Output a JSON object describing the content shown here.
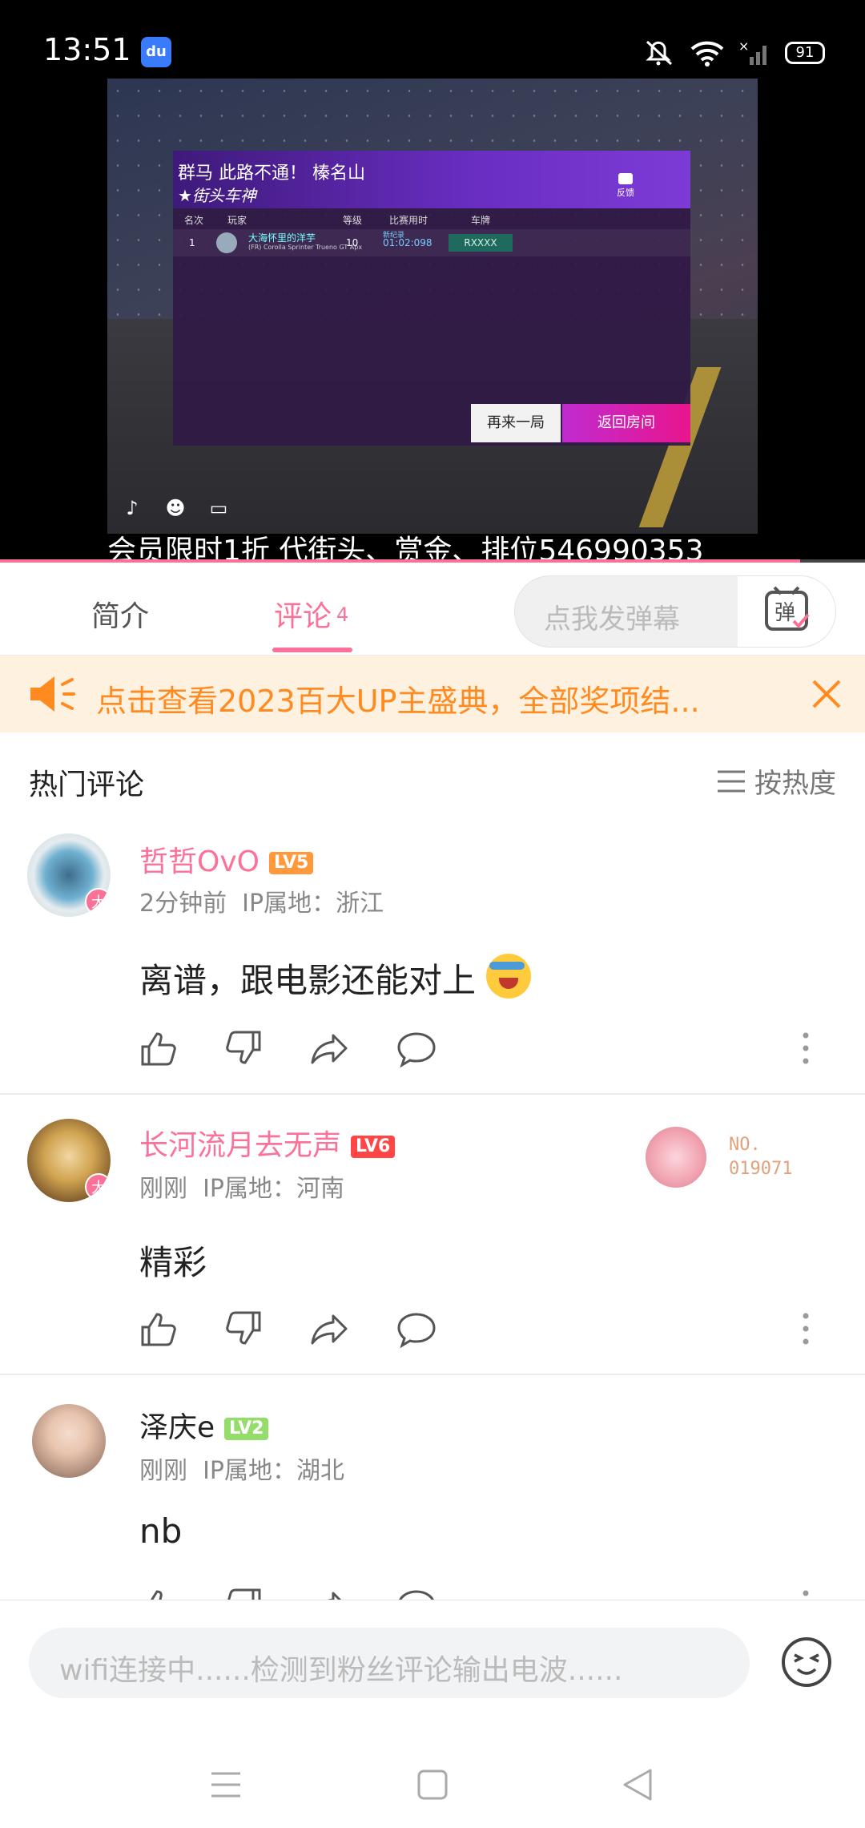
{
  "status_bar": {
    "time": "13:51",
    "battery": "91",
    "icons": [
      "baidu-app-icon",
      "mute-icon",
      "wifi-icon",
      "signal-icon",
      "battery-icon"
    ]
  },
  "video": {
    "game_title": "群马 此路不通！ 榛名山",
    "game_subtitle": "街头车神",
    "feedback_label": "反馈",
    "table_headers": [
      "名次",
      "玩家",
      "等级",
      "比赛用时",
      "车牌"
    ],
    "table_row": {
      "rank": "1",
      "player": "大海怀里的洋芋",
      "car": "(FR) Corolla Sprinter Trueno GT Apx",
      "level": "10",
      "time_label": "新纪录",
      "time": "01:02:098",
      "plate": "RXXXX"
    },
    "btn_again": "再来一局",
    "btn_return": "返回房间",
    "caption": "会员限时1折  代街头、赏金、排位546990353",
    "progress": 0.925
  },
  "tabs": {
    "intro": "简介",
    "comments": "评论",
    "comments_count": "4",
    "danmaku_placeholder": "点我发弹幕",
    "danmaku_button_label": "弹"
  },
  "banner": {
    "text": "点击查看2023百大UP主盛典，全部奖项结..."
  },
  "comments_section": {
    "header": "热门评论",
    "sort_label": "按热度"
  },
  "comments": [
    {
      "username": "哲哲OvO",
      "level": "LV5",
      "vip_badge": "大",
      "time": "2分钟前",
      "ip": "IP属地：浙江",
      "text": "离谱，跟电影还能对上"
    },
    {
      "username": "长河流月去无声",
      "level": "LV6",
      "vip_badge": "大",
      "time": "刚刚",
      "ip": "IP属地：河南",
      "text": "精彩",
      "fan_number_label": "NO.",
      "fan_number": "019071"
    },
    {
      "username": "泽庆e",
      "level": "LV2",
      "time": "刚刚",
      "ip": "IP属地：湖北",
      "text": "nb"
    }
  ],
  "bottom_input": {
    "placeholder": "wifi连接中......检测到粉丝评论输出电波......"
  },
  "colors": {
    "accent_pink": "#fb7299",
    "banner_orange": "#ff8a1f",
    "lv5": "#ff9a3c",
    "lv6": "#ff4545",
    "lv2": "#95dd6b"
  }
}
